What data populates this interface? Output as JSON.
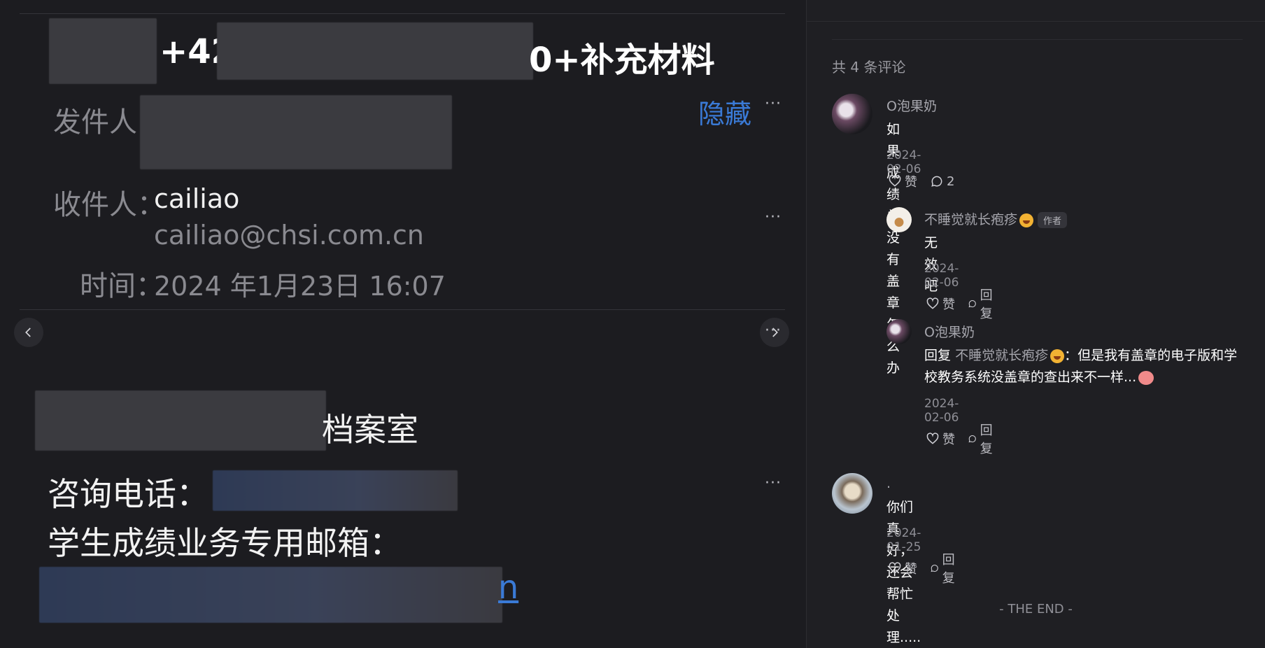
{
  "viewer": {
    "subject_visible_1": "+42",
    "subject_visible_2": "0+补充材料",
    "sender_label": "发件人",
    "hide_label": "隐藏",
    "recipient_label": "收件人：",
    "recipient_name": "cailiao",
    "recipient_email": "cailiao@chsi.com.cn",
    "time_label": "时间：",
    "time_value": "2024 年1月23日 16:07",
    "archive_suffix": "档案室",
    "phone_label": "咨询电话：",
    "email_label": "学生成绩业务专用邮箱：",
    "email_tail": "n"
  },
  "comments": {
    "total": "共 4 条评论",
    "more": "···",
    "like_label": "赞",
    "reply_label": "回复",
    "author_tag": "作者",
    "items": [
      {
        "user": "O泡果奶",
        "text": "如果成绩单没有盖章怎么办",
        "date": "2024-02-06",
        "reply_count": "2"
      },
      {
        "user": "不睡觉就长疱疹",
        "text": "无效吧",
        "date": "2024-02-06"
      },
      {
        "user": "O泡果奶",
        "reply_prefix": "回复",
        "reply_to": "不睡觉就长疱疹",
        "text": "：但是我有盖章的电子版和学校教务系统没盖章的查出来不一样...",
        "date": "2024-02-06"
      },
      {
        "user": ".",
        "text": "你们真好，还会帮忙处理.....",
        "date": "2024-01-25"
      }
    ],
    "end_text": "- THE END -"
  },
  "colors": {
    "background": "#1f1f23",
    "link_blue": "#3a7ad6",
    "text_secondary": "#8f8f96"
  }
}
